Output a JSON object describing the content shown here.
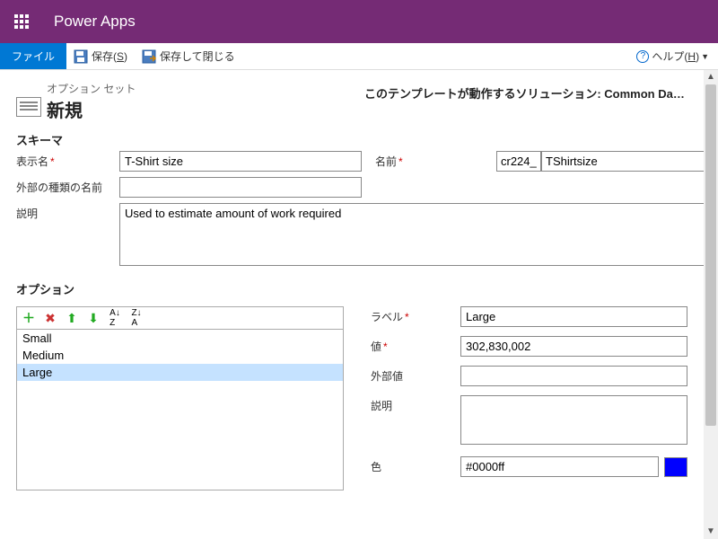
{
  "titlebar": {
    "app_name": "Power Apps"
  },
  "ribbon": {
    "file": "ファイル",
    "save": "保存(S)",
    "save_close": "保存して閉じる",
    "help": "ヘルプ(H)"
  },
  "header": {
    "record_type": "オプション セット",
    "record_name": "新規",
    "solution_label": "このテンプレートが動作するソリューション: Common Data Service…"
  },
  "schema": {
    "heading": "スキーマ",
    "display_name_label": "表示名",
    "display_name_value": "T-Shirt size",
    "name_label": "名前",
    "name_prefix": "cr224_",
    "name_suffix": "TShirtsize",
    "external_name_label": "外部の種類の名前",
    "external_name_value": "",
    "description_label": "説明",
    "description_value": "Used to estimate amount of work required"
  },
  "options": {
    "heading": "オプション",
    "items": [
      {
        "label": "Small"
      },
      {
        "label": "Medium"
      },
      {
        "label": "Large"
      }
    ],
    "selected_index": 2,
    "detail": {
      "label_label": "ラベル",
      "label_value": "Large",
      "value_label": "値",
      "value_value": "302,830,002",
      "external_value_label": "外部値",
      "external_value_value": "",
      "description_label": "説明",
      "description_value": "",
      "color_label": "色",
      "color_value": "#0000ff"
    }
  }
}
